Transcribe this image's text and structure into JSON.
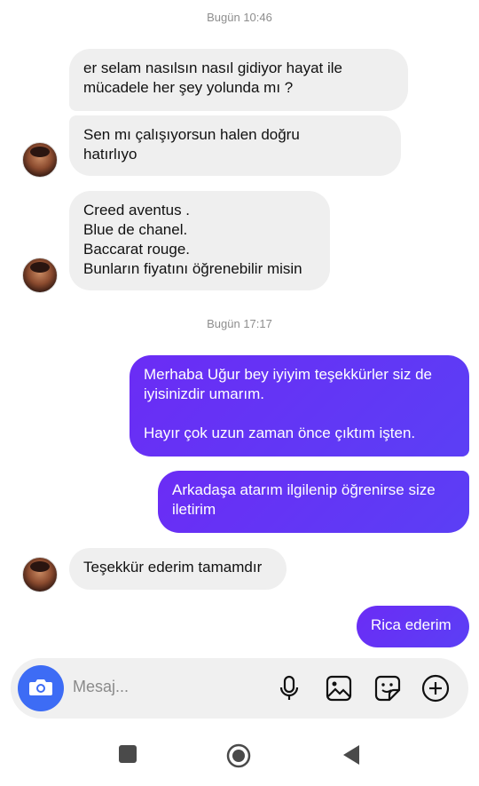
{
  "timestamps": [
    "Bugün 10:46",
    "Bugün 17:17"
  ],
  "messages": {
    "m1": "er  selam nasılsın nasıl gidiyor hayat ile\nmücadele her şey yolunda mı ?",
    "m2": "Sen              mı çalışıyorsun halen doğru\nhatırlıyo",
    "m3": "Creed aventus .\nBlue de chanel.\nBaccarat rouge.\nBunların fiyatını öğrenebilir misin",
    "m4": "Merhaba Uğur bey iyiyim teşekkürler siz de\niyisinizdir umarım.\n\nHayır çok uzun zaman önce çıktım işten.",
    "m5": "Arkadaşa atarım ilgilenip öğrenirse size\niletirim",
    "m6": "Teşekkür ederim tamamdır",
    "m7": "Rica ederim"
  },
  "composer": {
    "placeholder": "Mesaj..."
  },
  "icons": {
    "camera": "camera-icon",
    "mic": "microphone-icon",
    "gallery": "image-icon",
    "sticker": "sticker-icon",
    "add": "plus-circle-icon",
    "nav_recents": "square-icon",
    "nav_home": "circle-icon",
    "nav_back": "triangle-back-icon"
  },
  "colors": {
    "outgoing": "#5f39f5",
    "incoming": "#efefef",
    "camera_button": "#3d6cf5"
  }
}
